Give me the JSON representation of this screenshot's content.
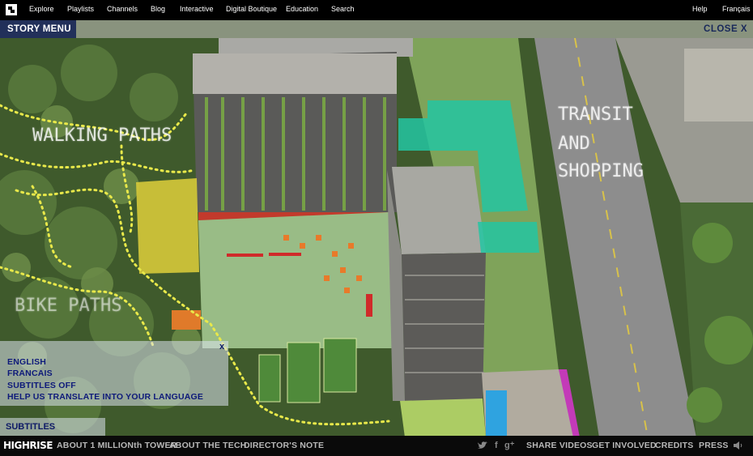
{
  "topnav": {
    "items": [
      "Explore",
      "Playlists",
      "Channels",
      "Blog",
      "Interactive",
      "Digital Boutique",
      "Education",
      "Search"
    ],
    "help": "Help",
    "lang": "Français"
  },
  "story": {
    "menu_label": "STORY MENU",
    "close_label": "CLOSE X"
  },
  "scene": {
    "labels": {
      "walking": "WALKING PATHS",
      "bike": "BIKE PATHS",
      "transit1": "TRANSIT",
      "transit2": "AND",
      "transit3": "SHOPPING"
    }
  },
  "subtitles_panel": {
    "close": "x",
    "options": [
      "ENGLISH",
      "FRANCAIS",
      "SUBTITLES OFF",
      "HELP US TRANSLATE INTO YOUR LANGUAGE"
    ],
    "toggle": "SUBTITLES"
  },
  "bottom": {
    "brand": "HIGHRISE",
    "links": [
      "ABOUT 1 MILLIONth TOWER",
      "ABOUT THE TECH",
      "DIRECTOR'S NOTE"
    ],
    "right_links": [
      "SHARE VIDEOS",
      "GET INVOLVED",
      "CREDITS",
      "PRESS"
    ],
    "social_icons": [
      "twitter-icon",
      "facebook-icon",
      "google-plus-icon"
    ]
  }
}
